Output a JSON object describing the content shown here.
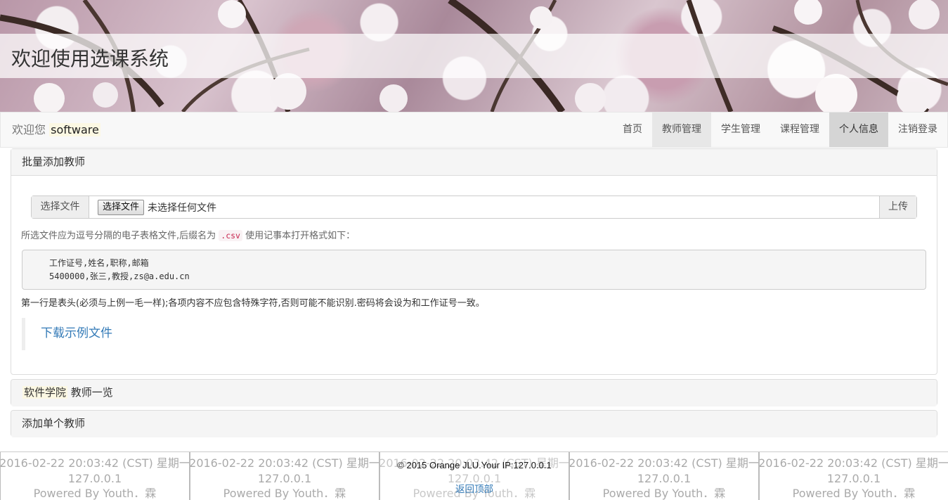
{
  "banner": {
    "title": "欢迎使用选课系统"
  },
  "navbar": {
    "welcome": "欢迎您",
    "username": "software",
    "items": [
      {
        "label": "首页"
      },
      {
        "label": "教师管理"
      },
      {
        "label": "学生管理"
      },
      {
        "label": "课程管理"
      },
      {
        "label": "个人信息"
      },
      {
        "label": "注销登录"
      }
    ]
  },
  "batch_panel": {
    "heading": "批量添加教师",
    "file_addon": "选择文件",
    "file_button": "选择文件",
    "file_status": "未选择任何文件",
    "upload_button": "上传",
    "help_before": "所选文件应为逗号分隔的电子表格文件,后缀名为",
    "help_code": ".csv",
    "help_after": "使用记事本打开格式如下：",
    "example_line1": "工作证号,姓名,职称,邮箱",
    "example_line2": "5400000,张三,教授,zs@a.edu.cn",
    "note": "第一行是表头(必须与上例一毛一样);各项内容不应包含特殊字符,否则可能不能识别.密码将会设为和工作证号一致。",
    "download_link": "下载示例文件"
  },
  "list_panel": {
    "college": "软件学院",
    "heading": "教师一览"
  },
  "single_panel": {
    "heading": "添加单个教师"
  },
  "footer": {
    "datetime": "2016-02-22 20:03:42 (CST) 星期一",
    "ip": "127.0.0.1",
    "powered": "Powered By Youth．霖",
    "copyright": "© 2015 Orange JLU.Your IP:127.0.0.1",
    "back_to_top": "返回顶部"
  }
}
